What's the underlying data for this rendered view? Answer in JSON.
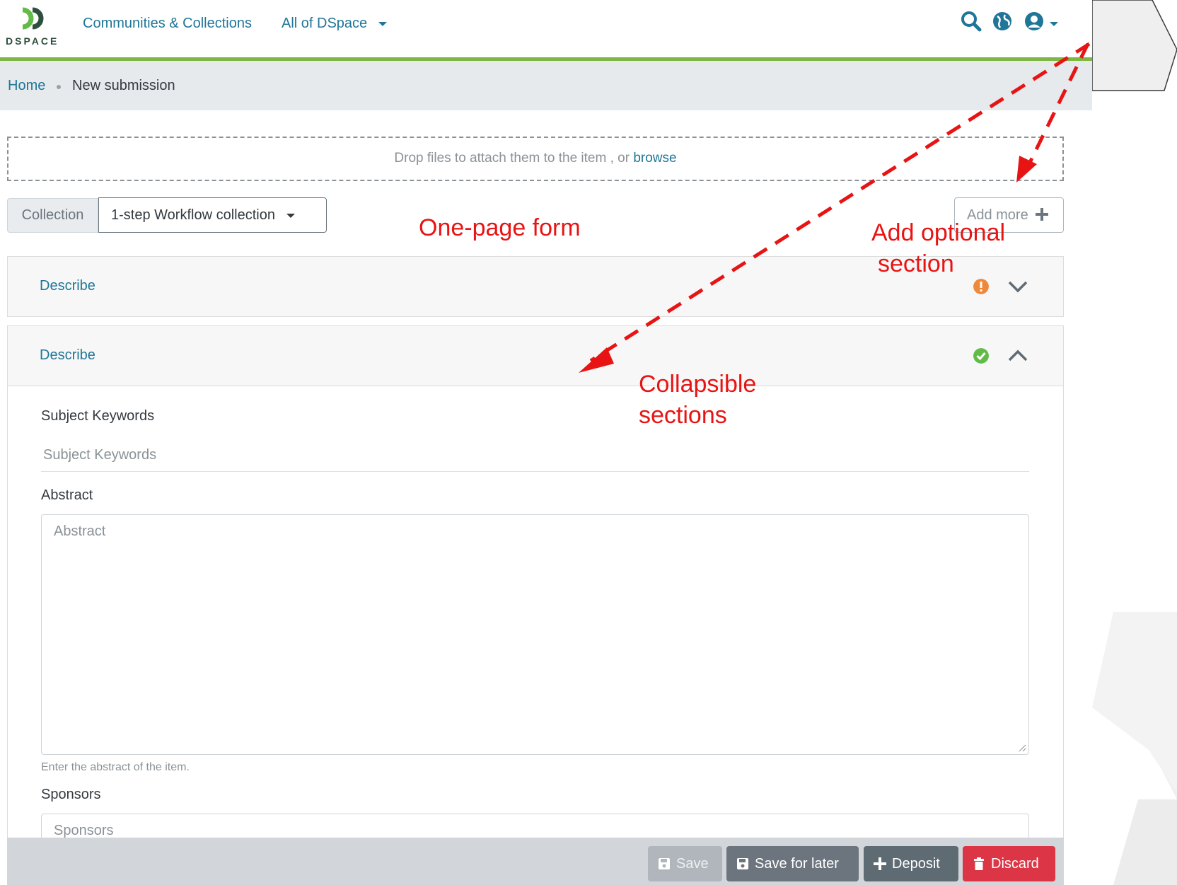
{
  "header": {
    "logo_text": "DSPACE",
    "nav": {
      "communities_label": "Communities & Collections",
      "all_label": "All of DSpace"
    },
    "icons": [
      "search-icon",
      "globe-icon",
      "user-icon"
    ]
  },
  "breadcrumb": {
    "home": "Home",
    "current": "New submission"
  },
  "dropzone": {
    "text": "Drop files to attach them to the item , or",
    "link": "browse"
  },
  "collection": {
    "label": "Collection",
    "value": "1-step Workflow collection"
  },
  "add_more": {
    "label": "Add more"
  },
  "sections": [
    {
      "title": "Describe",
      "status": "warning",
      "state": "collapsed",
      "status_color": "#f0883a"
    },
    {
      "title": "Describe",
      "status": "valid",
      "state": "expanded",
      "status_color": "#62bb47"
    }
  ],
  "form": {
    "subject": {
      "label": "Subject Keywords",
      "placeholder": "Subject Keywords"
    },
    "abstract": {
      "label": "Abstract",
      "placeholder": "Abstract",
      "help": "Enter the abstract of the item."
    },
    "sponsors": {
      "label": "Sponsors",
      "placeholder": "Sponsors"
    }
  },
  "footer": {
    "save": "Save",
    "save_later": "Save for later",
    "deposit": "Deposit",
    "discard": "Discard"
  },
  "annotations": {
    "one_page": "One-page form",
    "optional_1": "Add optional",
    "optional_2": "section",
    "collapsible_1": "Collapsible",
    "collapsible_2": "sections"
  },
  "colors": {
    "accent": "#207698",
    "green_bar": "#7bb742",
    "annotation": "#e81414",
    "discard": "#dc3545"
  }
}
